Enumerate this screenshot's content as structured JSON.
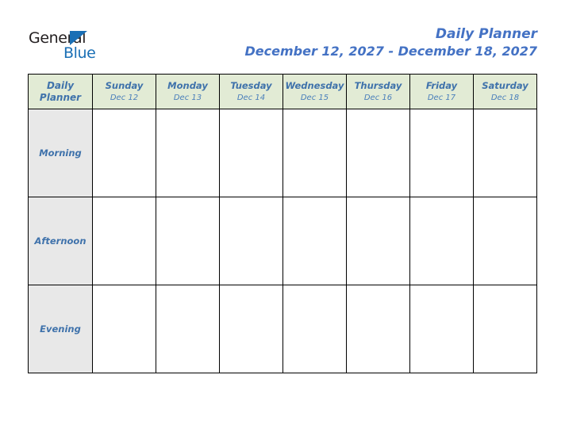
{
  "brand": {
    "name_part1": "General",
    "name_part2": "Blue",
    "triangle_icon": "triangle-icon",
    "color_dark": "#231f20",
    "color_blue": "#1a6fb5"
  },
  "header": {
    "title": "Daily Planner",
    "date_range": "December 12, 2027 - December 18, 2027",
    "title_color": "#4472c4"
  },
  "table": {
    "corner": {
      "line1": "Daily",
      "line2": "Planner"
    },
    "header_bg": "#e2ebd5",
    "label_bg": "#e8e8e8",
    "border_color": "#000000",
    "text_color": "#3f72ab",
    "columns": [
      {
        "day": "Sunday",
        "date": "Dec 12"
      },
      {
        "day": "Monday",
        "date": "Dec 13"
      },
      {
        "day": "Tuesday",
        "date": "Dec 14"
      },
      {
        "day": "Wednesday",
        "date": "Dec 15"
      },
      {
        "day": "Thursday",
        "date": "Dec 16"
      },
      {
        "day": "Friday",
        "date": "Dec 17"
      },
      {
        "day": "Saturday",
        "date": "Dec 18"
      }
    ],
    "rows": [
      {
        "label": "Morning",
        "slots": [
          "",
          "",
          "",
          "",
          "",
          "",
          ""
        ]
      },
      {
        "label": "Afternoon",
        "slots": [
          "",
          "",
          "",
          "",
          "",
          "",
          ""
        ]
      },
      {
        "label": "Evening",
        "slots": [
          "",
          "",
          "",
          "",
          "",
          "",
          ""
        ]
      }
    ]
  }
}
